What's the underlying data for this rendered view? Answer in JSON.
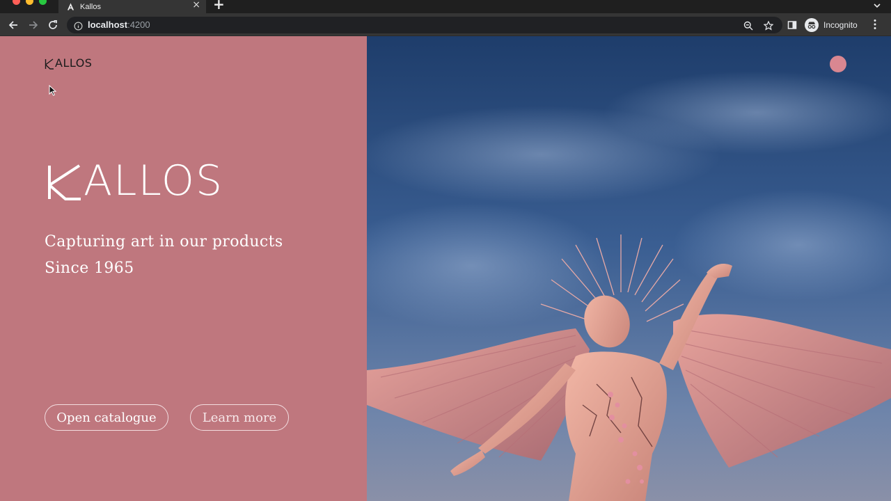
{
  "browser": {
    "tab_title": "Kallos",
    "tab_favicon": "angular-icon",
    "new_tab_label": "+",
    "url_host": "localhost",
    "url_port": ":4200",
    "profile_label": "Incognito"
  },
  "page": {
    "nav_logo_text": "ALLOS",
    "hero_logo_text": "ALLOS",
    "tagline_line1": "Capturing art in our products",
    "tagline_line2": "Since 1965",
    "primary_button": "Open catalogue",
    "secondary_button": "Learn more"
  },
  "colors": {
    "panel_bg": "#bf777e",
    "accent_dot": "#d98791",
    "sky_top": "#1f3f6e",
    "sky_bottom": "#7a8fb0"
  },
  "hero_image": {
    "alt": "sculpture-figure-with-pink-wings-and-blossoms-icon"
  }
}
